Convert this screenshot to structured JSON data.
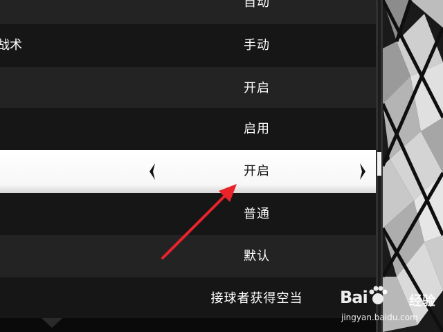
{
  "menu": {
    "rows": [
      {
        "label": "",
        "value": "自动"
      },
      {
        "label": "战术",
        "value": "手动"
      },
      {
        "label": "",
        "value": "开启"
      },
      {
        "label": "",
        "value": "启用"
      },
      {
        "label": "",
        "value": "开启",
        "selected": true
      },
      {
        "label": "",
        "value": "普通"
      },
      {
        "label": "",
        "value": "默认"
      },
      {
        "label": "",
        "value": "接球者获得空当"
      }
    ]
  },
  "icons": {
    "left": "chevron-left-icon",
    "right": "chevron-right-icon",
    "annotation": "red-arrow-icon"
  },
  "colors": {
    "annotation": "#e8232a",
    "selected_row": "#ffffff",
    "row_dark": "#161616",
    "row_light": "#232323"
  },
  "watermark": {
    "brand": "Bai",
    "brand_suffix": "经验",
    "url": "jingyan.baidu.com"
  }
}
